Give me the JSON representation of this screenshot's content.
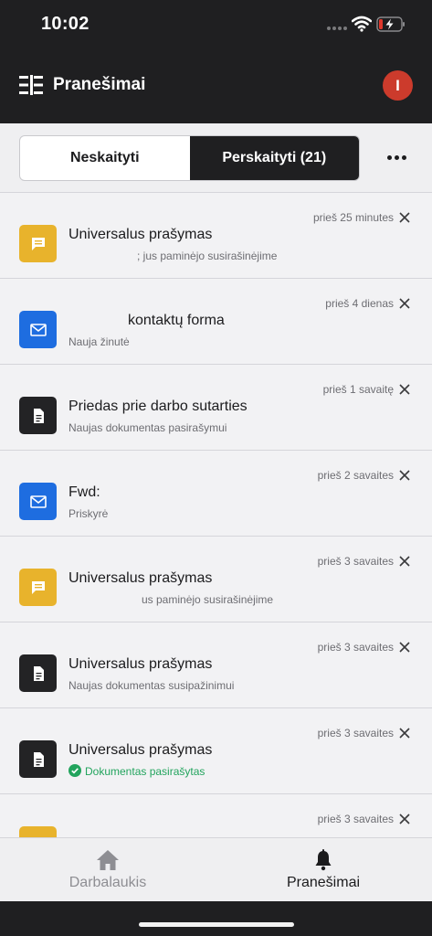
{
  "status_bar": {
    "time": "10:02"
  },
  "header": {
    "title": "Pranešimai",
    "avatar_initial": "I"
  },
  "tabs": [
    {
      "label": "Neskaityti",
      "active": false
    },
    {
      "label": "Perskaityti (21)",
      "active": true
    }
  ],
  "notifications": [
    {
      "icon": "message-icon",
      "color": "#e8b32c",
      "title": "Universalus prašymas",
      "subtitle": "; jus paminėjo susirašinėjime",
      "time": "prieš 25 minutes"
    },
    {
      "icon": "mail-icon",
      "color": "#1e6de0",
      "title": "kontaktų forma",
      "subtitle": "Nauja žinutė",
      "time": "prieš 4 dienas"
    },
    {
      "icon": "document-icon",
      "color": "#232325",
      "title": "Priedas prie darbo sutarties",
      "subtitle": "Naujas dokumentas pasirašymui",
      "time": "prieš 1 savaitę"
    },
    {
      "icon": "mail-icon",
      "color": "#1e6de0",
      "title": "Fwd:",
      "subtitle": "Priskyrė",
      "time": "prieš 2 savaites"
    },
    {
      "icon": "message-icon",
      "color": "#e8b32c",
      "title": "Universalus prašymas",
      "subtitle": "us paminėjo susirašinėjime",
      "time": "prieš 3 savaites"
    },
    {
      "icon": "document-icon",
      "color": "#232325",
      "title": "Universalus prašymas",
      "subtitle": "Naujas dokumentas susipažinimui",
      "time": "prieš 3 savaites"
    },
    {
      "icon": "document-icon",
      "color": "#232325",
      "title": "Universalus prašymas",
      "subtitle": "Dokumentas pasirašytas",
      "subtitle_status": "success",
      "time": "prieš 3 savaites"
    },
    {
      "icon": "message-icon",
      "color": "#e8b32c",
      "title": "",
      "subtitle": "",
      "time": "prieš 3 savaites"
    }
  ],
  "bottom_nav": [
    {
      "label": "Darbalaukis",
      "icon": "home-icon",
      "active": false
    },
    {
      "label": "Pranešimai",
      "icon": "bell-icon",
      "active": true
    }
  ]
}
